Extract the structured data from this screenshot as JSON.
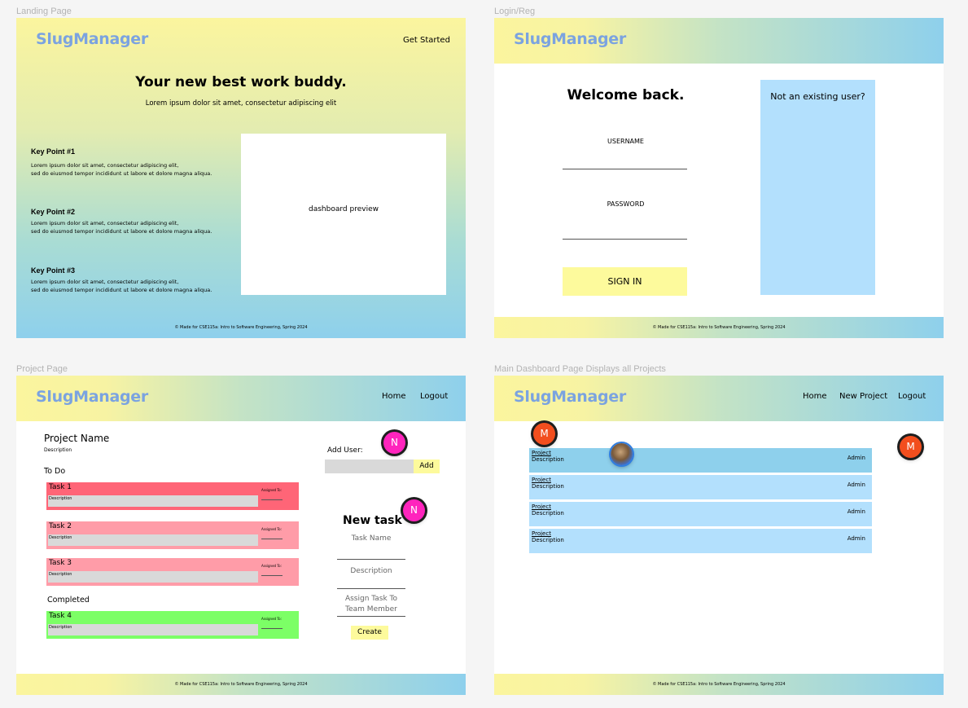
{
  "frames": {
    "landing": {
      "label": "Landing Page"
    },
    "login": {
      "label": "Login/Reg"
    },
    "project": {
      "label": "Project Page"
    },
    "dashboard": {
      "label": "Main Dashboard Page Displays all Projects"
    }
  },
  "brand": "SlugManager",
  "footer_text": "© Made for CSE115a: Intro to Software Engineering, Spring 2024",
  "landing": {
    "nav_cta": "Get Started",
    "headline": "Your new best work buddy.",
    "subheadline": "Lorem ipsum dolor sit amet, consectetur adipiscing elit",
    "key_points": [
      {
        "title": "Key Point #1",
        "line1": "Lorem ipsum dolor sit amet, consectetur adipiscing elit,",
        "line2": "sed do eiusmod tempor incididunt ut labore et dolore magna aliqua."
      },
      {
        "title": "Key Point #2",
        "line1": "Lorem ipsum dolor sit amet, consectetur adipiscing elit,",
        "line2": "sed do eiusmod tempor incididunt ut labore et dolore magna aliqua."
      },
      {
        "title": "Key Point #3",
        "line1": "Lorem ipsum dolor sit amet, consectetur adipiscing elit,",
        "line2": "sed do eiusmod tempor incididunt ut labore et dolore magna aliqua."
      }
    ],
    "preview_label": "dashboard preview"
  },
  "login": {
    "title": "Welcome back.",
    "username_label": "USERNAME",
    "password_label": "PASSWORD",
    "signin_label": "SIGN IN",
    "new_user_text": "Not an existing user?"
  },
  "project": {
    "nav": {
      "home": "Home",
      "logout": "Logout"
    },
    "project_name": "Project Name",
    "description": "Description",
    "todo_heading": "To Do",
    "completed_heading": "Completed",
    "tasks": [
      {
        "title": "Task 1",
        "desc": "Description",
        "assigned": "Assigned To:"
      },
      {
        "title": "Task 2",
        "desc": "Description",
        "assigned": "Assigned To:"
      },
      {
        "title": "Task 3",
        "desc": "Description",
        "assigned": "Assigned To:"
      },
      {
        "title": "Task 4",
        "desc": "Description",
        "assigned": "Assigned To:"
      }
    ],
    "add_user_label": "Add User:",
    "add_button": "Add",
    "new_task_title": "New task",
    "task_name_placeholder": "Task Name",
    "description_placeholder": "Description",
    "assign_placeholder_line1": "Assign Task To",
    "assign_placeholder_line2": "Team Member",
    "create_button": "Create",
    "avatar_initial": "N"
  },
  "dashboard": {
    "nav": {
      "home": "Home",
      "new_project": "New Project",
      "logout": "Logout"
    },
    "projects": [
      {
        "link": "Project",
        "desc": "Description",
        "role": "Admin"
      },
      {
        "link": "Project",
        "desc": "Description",
        "role": "Admin"
      },
      {
        "link": "Project",
        "desc": "Description",
        "role": "Admin"
      },
      {
        "link": "Project",
        "desc": "Description",
        "role": "Admin"
      }
    ],
    "avatar_initial": "M"
  },
  "colors": {
    "brand": "#7ba3e0",
    "task_todo_active": "#ff6577",
    "task_todo": "#ff9ca8",
    "task_done": "#7cff66",
    "yellow_button": "#fdfa9c",
    "light_blue": "#b3e0fd",
    "avatar_n": "#ff24bd",
    "avatar_m": "#f24e1e"
  }
}
